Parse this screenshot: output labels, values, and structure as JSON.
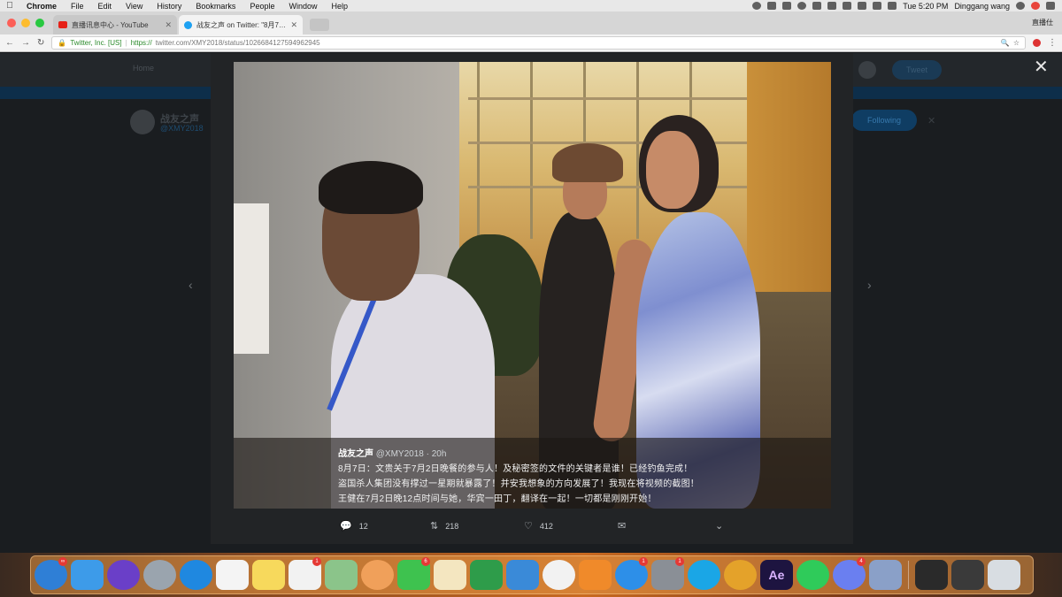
{
  "menubar": {
    "app": "Chrome",
    "items": [
      "File",
      "Edit",
      "View",
      "History",
      "Bookmarks",
      "People",
      "Window",
      "Help"
    ],
    "clock": "Tue 5:20 PM",
    "user": "Dinggang wang"
  },
  "tabs": [
    {
      "title": "直播讯息中心 - YouTube",
      "favicon": "youtube-icon"
    },
    {
      "title": "战友之声 on Twitter: \"8月7日...",
      "favicon": "twitter-icon"
    }
  ],
  "profile_label": "直播仕",
  "address": {
    "security": "Twitter, Inc. [US]",
    "separator": "|",
    "protocol": "https://",
    "url": "twitter.com/XMY2018/status/1026684127594962945"
  },
  "background_page": {
    "nav_home": "Home",
    "tweet_button": "Tweet",
    "profile_name": "战友之声",
    "profile_handle": "@XMY2018",
    "follow_button": "Following"
  },
  "tweet": {
    "author": "战友之声",
    "handle": "@XMY2018",
    "time": "· 20h",
    "lines": [
      "8月7日：文贵关于7月2日晚餐的参与人！及秘密签的文件的关键者是谁！已经钓鱼完成！",
      "盗国杀人集团没有撑过一星期就暴露了！并安我想象的方向发展了！我现在将视频的截图！",
      "王健在7月2日晚12点时间与她，华宾一田丁，翻译在一起！一切都是刚刚开始！"
    ],
    "replies": "12",
    "retweets": "218",
    "likes": "412"
  },
  "dock": {
    "apps": [
      {
        "name": "safari-icon",
        "color": "#2f7fd6",
        "round": true,
        "badge": "∞"
      },
      {
        "name": "finder-icon",
        "color": "#3d9be9"
      },
      {
        "name": "siri-icon",
        "color": "#6a3fc8",
        "round": true
      },
      {
        "name": "launchpad-icon",
        "color": "#9aa4ae",
        "round": true
      },
      {
        "name": "safari-compass-icon",
        "color": "#1f88e0",
        "round": true
      },
      {
        "name": "calendar-icon",
        "color": "#f4f4f4"
      },
      {
        "name": "notes-icon",
        "color": "#f7d95c"
      },
      {
        "name": "reminders-icon",
        "color": "#f2f2f2",
        "badge": "1"
      },
      {
        "name": "maps-icon",
        "color": "#8bc48a"
      },
      {
        "name": "photos-icon",
        "color": "#f0a05a",
        "round": true
      },
      {
        "name": "messages-icon",
        "color": "#3ec24f",
        "badge": "6"
      },
      {
        "name": "stickies-icon",
        "color": "#f4e6c0"
      },
      {
        "name": "numbers-icon",
        "color": "#2e9c4a"
      },
      {
        "name": "keynote-icon",
        "color": "#3a8ad8"
      },
      {
        "name": "itunes-icon",
        "color": "#f2f2f2",
        "round": true
      },
      {
        "name": "ibooks-icon",
        "color": "#f08a2a"
      },
      {
        "name": "app-store-icon",
        "color": "#2d8fe8",
        "round": true,
        "badge": "1"
      },
      {
        "name": "system-preferences-icon",
        "color": "#8a8f96",
        "badge": "1"
      },
      {
        "name": "skype-icon",
        "color": "#1aa6e6",
        "round": true
      },
      {
        "name": "chrome-icon",
        "color": "#e4a22a",
        "round": true
      },
      {
        "name": "after-effects-icon",
        "color": "#1d1440",
        "label": "Ae"
      },
      {
        "name": "whatsapp-icon",
        "color": "#2fcb5a",
        "round": true
      },
      {
        "name": "discord-icon",
        "color": "#6a7ff0",
        "round": true,
        "badge": "4"
      },
      {
        "name": "image-capture-icon",
        "color": "#8aa0c8"
      }
    ],
    "trailing": [
      {
        "name": "screen-recording-icon",
        "color": "#2a2a2a"
      },
      {
        "name": "display-icon",
        "color": "#3a3a3a"
      },
      {
        "name": "trash-icon",
        "color": "#d8dde2"
      }
    ]
  }
}
